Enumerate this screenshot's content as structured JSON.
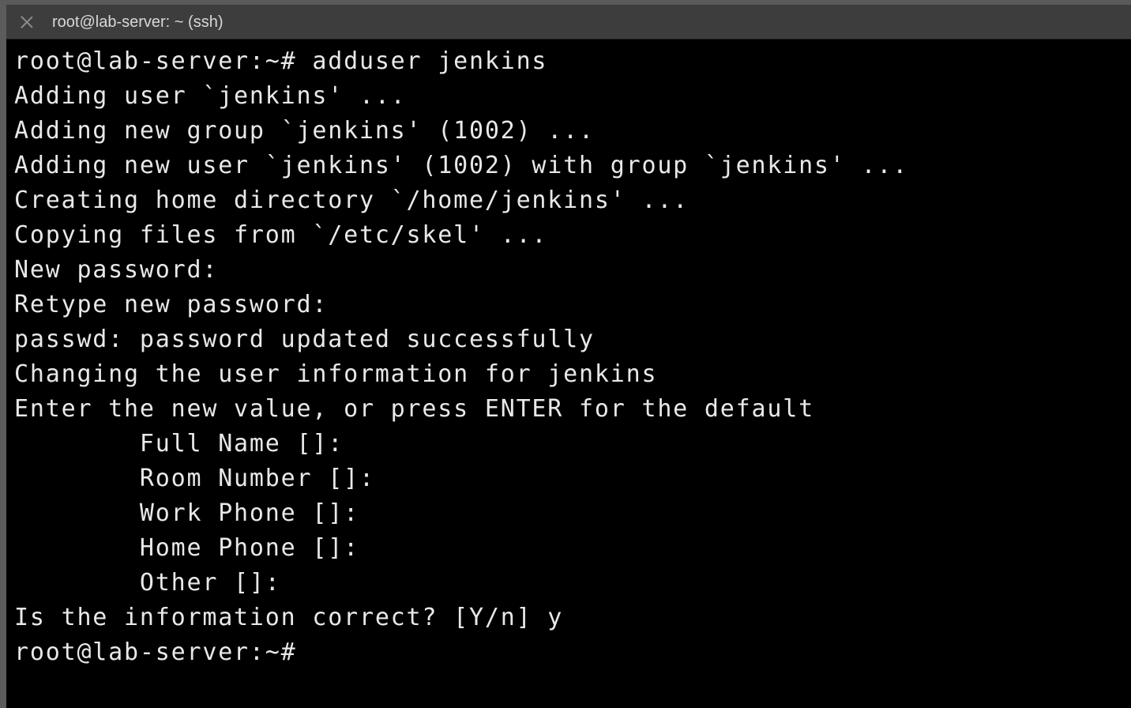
{
  "window": {
    "tab_title": "root@lab-server: ~ (ssh)"
  },
  "terminal": {
    "lines": [
      "root@lab-server:~# adduser jenkins",
      "Adding user `jenkins' ...",
      "Adding new group `jenkins' (1002) ...",
      "Adding new user `jenkins' (1002) with group `jenkins' ...",
      "Creating home directory `/home/jenkins' ...",
      "Copying files from `/etc/skel' ...",
      "New password:",
      "Retype new password:",
      "passwd: password updated successfully",
      "Changing the user information for jenkins",
      "Enter the new value, or press ENTER for the default",
      "        Full Name []:",
      "        Room Number []:",
      "        Work Phone []:",
      "        Home Phone []:",
      "        Other []:",
      "Is the information correct? [Y/n] y",
      "root@lab-server:~#"
    ]
  },
  "colors": {
    "terminal_bg": "#000000",
    "terminal_fg": "#e8e8e8",
    "tabbar_bg": "#3d3d3d"
  }
}
